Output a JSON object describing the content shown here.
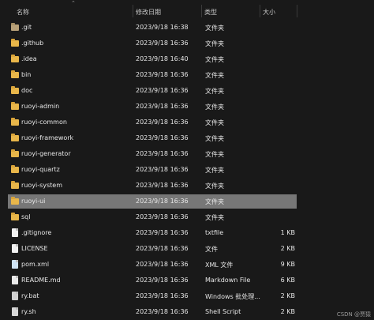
{
  "header": {
    "name": "名称",
    "date": "修改日期",
    "type": "类型",
    "size": "大小",
    "sort_arrow": "⌃"
  },
  "files": [
    {
      "name": ".git",
      "date": "2023/9/18 16:38",
      "type": "文件夹",
      "size": "",
      "icon": "folder-icon"
    },
    {
      "name": ".github",
      "date": "2023/9/18 16:36",
      "type": "文件夹",
      "size": "",
      "icon": "folder-icon"
    },
    {
      "name": ".idea",
      "date": "2023/9/18 16:40",
      "type": "文件夹",
      "size": "",
      "icon": "folder-icon"
    },
    {
      "name": "bin",
      "date": "2023/9/18 16:36",
      "type": "文件夹",
      "size": "",
      "icon": "folder-icon"
    },
    {
      "name": "doc",
      "date": "2023/9/18 16:36",
      "type": "文件夹",
      "size": "",
      "icon": "folder-icon"
    },
    {
      "name": "ruoyi-admin",
      "date": "2023/9/18 16:36",
      "type": "文件夹",
      "size": "",
      "icon": "folder-icon"
    },
    {
      "name": "ruoyi-common",
      "date": "2023/9/18 16:36",
      "type": "文件夹",
      "size": "",
      "icon": "folder-icon"
    },
    {
      "name": "ruoyi-framework",
      "date": "2023/9/18 16:36",
      "type": "文件夹",
      "size": "",
      "icon": "folder-icon"
    },
    {
      "name": "ruoyi-generator",
      "date": "2023/9/18 16:36",
      "type": "文件夹",
      "size": "",
      "icon": "folder-icon"
    },
    {
      "name": "ruoyi-quartz",
      "date": "2023/9/18 16:36",
      "type": "文件夹",
      "size": "",
      "icon": "folder-icon"
    },
    {
      "name": "ruoyi-system",
      "date": "2023/9/18 16:36",
      "type": "文件夹",
      "size": "",
      "icon": "folder-icon"
    },
    {
      "name": "ruoyi-ui",
      "date": "2023/9/18 16:36",
      "type": "文件夹",
      "size": "",
      "icon": "folder-icon",
      "selected": true
    },
    {
      "name": "sql",
      "date": "2023/9/18 16:36",
      "type": "文件夹",
      "size": "",
      "icon": "folder-icon"
    },
    {
      "name": ".gitignore",
      "date": "2023/9/18 16:36",
      "type": "txtfile",
      "size": "1 KB",
      "icon": "file-icon"
    },
    {
      "name": "LICENSE",
      "date": "2023/9/18 16:36",
      "type": "文件",
      "size": "2 KB",
      "icon": "file-icon"
    },
    {
      "name": "pom.xml",
      "date": "2023/9/18 16:36",
      "type": "XML 文件",
      "size": "9 KB",
      "icon": "xml-file-icon"
    },
    {
      "name": "README.md",
      "date": "2023/9/18 16:36",
      "type": "Markdown File",
      "size": "6 KB",
      "icon": "markdown-file-icon"
    },
    {
      "name": "ry.bat",
      "date": "2023/9/18 16:36",
      "type": "Windows 批处理...",
      "size": "2 KB",
      "icon": "batch-file-icon"
    },
    {
      "name": "ry.sh",
      "date": "2023/9/18 16:36",
      "type": "Shell Script",
      "size": "2 KB",
      "icon": "shell-file-icon"
    }
  ],
  "watermark": "CSDN @贾猿",
  "colors": {
    "background": "#191919",
    "selected_row": "#777777",
    "folder": "#e8b64a",
    "text": "#e6e6e6"
  }
}
